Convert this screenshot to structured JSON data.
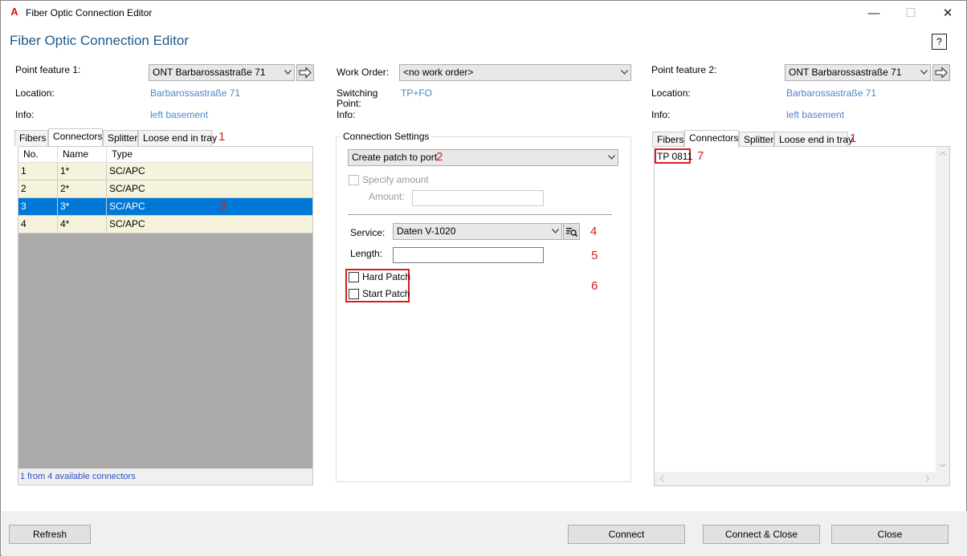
{
  "window": {
    "title": "Fiber Optic Connection Editor",
    "minimize": "—",
    "maximize": "☐",
    "close": "✕"
  },
  "header": {
    "title": "Fiber Optic Connection Editor",
    "help": "?"
  },
  "left": {
    "point_label": "Point feature 1:",
    "point_value": "ONT Barbarossastraße 71",
    "location_label": "Location:",
    "location_value": "Barbarossastraße 71",
    "info_label": "Info:",
    "info_value": "left basement",
    "tabs": [
      "Fibers",
      "Connectors",
      "Splitter",
      "Loose end in tray"
    ],
    "active_tab": "Connectors",
    "marker_tabs": "1",
    "marker_row": "3",
    "columns": [
      "No.",
      "Name",
      "Type"
    ],
    "rows": [
      {
        "no": "1",
        "name": "1*",
        "type": "SC/APC"
      },
      {
        "no": "2",
        "name": "2*",
        "type": "SC/APC"
      },
      {
        "no": "3",
        "name": "3*",
        "type": "SC/APC"
      },
      {
        "no": "4",
        "name": "4*",
        "type": "SC/APC"
      }
    ],
    "selected_row": 3,
    "footer": "1 from 4 available connectors"
  },
  "middle": {
    "workorder_label": "Work Order:",
    "workorder_value": "<no work order>",
    "switching_label_1": "Switching",
    "switching_label_2": "Point:",
    "switching_value": "TP+FO",
    "info_label": "Info:",
    "group_title": "Connection Settings",
    "mode_value": "Create patch to port",
    "marker_mode": "2",
    "specify_amount": "Specify amount",
    "amount_label": "Amount:",
    "service_label": "Service:",
    "service_value": "Daten V-1020",
    "marker_service": "4",
    "length_label": "Length:",
    "marker_length": "5",
    "hard_patch": "Hard Patch",
    "start_patch": "Start Patch",
    "marker_patch": "6"
  },
  "right": {
    "point_label": "Point feature 2:",
    "point_value": "ONT Barbarossastraße 71",
    "location_label": "Location:",
    "location_value": "Barbarossastraße 71",
    "info_label": "Info:",
    "info_value": "left basement",
    "tabs": [
      "Fibers",
      "Connectors",
      "Splitter",
      "Loose end in tray"
    ],
    "active_tab": "Connectors",
    "marker_tabs": "1",
    "list_item": "TP 0811",
    "marker_item": "7"
  },
  "buttons": {
    "refresh": "Refresh",
    "connect": "Connect",
    "connect_close": "Connect & Close",
    "close": "Close"
  },
  "colors": {
    "accent": "#0078d7",
    "link": "#4a86c8",
    "marker": "#d42020",
    "title": "#1e5a8a"
  }
}
